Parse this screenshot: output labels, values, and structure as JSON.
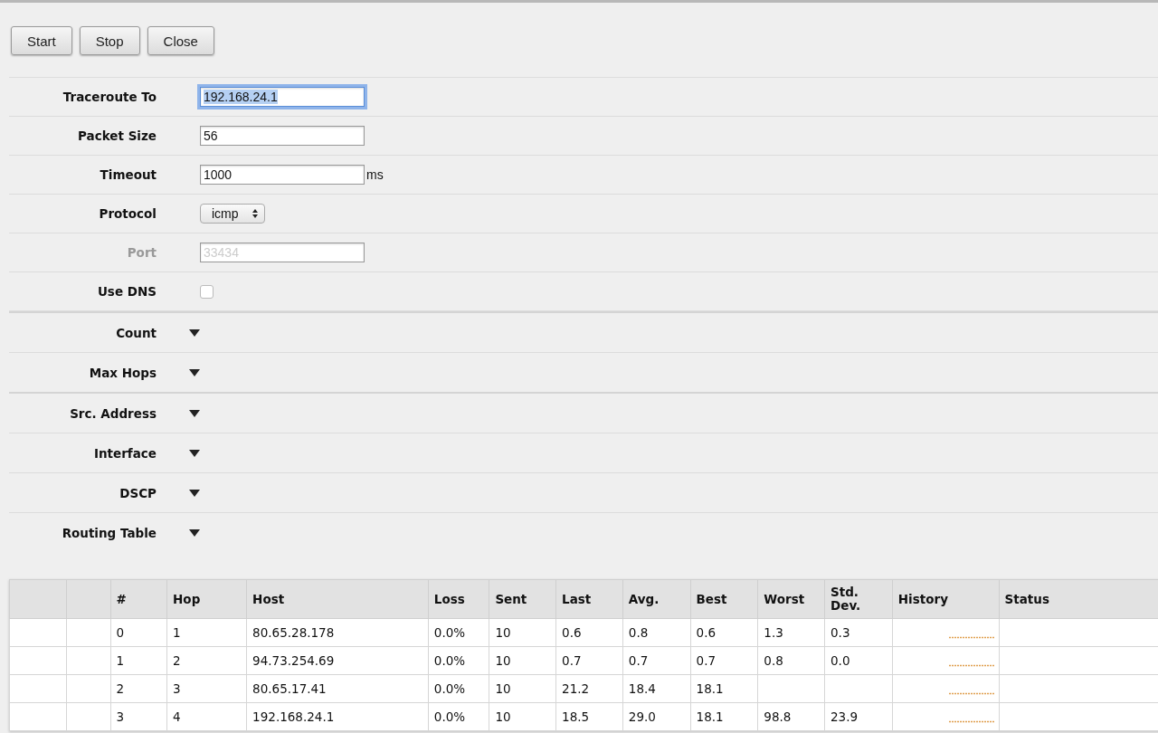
{
  "buttons": [
    {
      "label": "Start"
    },
    {
      "label": "Stop"
    },
    {
      "label": "Close"
    }
  ],
  "fields": [
    {
      "label": "Traceroute To",
      "kind": "text",
      "value": "192.168.24.1",
      "focused": true,
      "disabled": false
    },
    {
      "label": "Packet Size",
      "kind": "text",
      "value": "56",
      "focused": false,
      "disabled": false
    },
    {
      "label": "Timeout",
      "kind": "text",
      "value": "1000",
      "unit": "ms",
      "focused": false,
      "disabled": false
    },
    {
      "label": "Protocol",
      "kind": "select",
      "value": "icmp"
    },
    {
      "label": "Port",
      "kind": "text",
      "value": "33434",
      "focused": false,
      "disabled": true
    },
    {
      "label": "Use DNS",
      "kind": "checkbox",
      "checked": false
    }
  ],
  "section_groups": [
    [
      {
        "label": "Count",
        "expanded": false
      },
      {
        "label": "Max Hops",
        "expanded": false
      }
    ],
    [
      {
        "label": "Src. Address",
        "expanded": false
      },
      {
        "label": "Interface",
        "expanded": false
      },
      {
        "label": "DSCP",
        "expanded": false
      },
      {
        "label": "Routing Table",
        "expanded": false
      }
    ]
  ],
  "table": {
    "columns": [
      "#",
      "Hop",
      "Host",
      "Loss",
      "Sent",
      "Last",
      "Avg.",
      "Best",
      "Worst",
      "Std. Dev.",
      "History",
      "Status"
    ],
    "rows": [
      {
        "cells": [
          "0",
          "1",
          "80.65.28.178",
          "0.0%",
          "10",
          "0.6",
          "0.8",
          "0.6",
          "1.3",
          "0.3"
        ]
      },
      {
        "cells": [
          "1",
          "2",
          "94.73.254.69",
          "0.0%",
          "10",
          "0.7",
          "0.7",
          "0.7",
          "0.8",
          "0.0"
        ]
      },
      {
        "cells": [
          "2",
          "3",
          "80.65.17.41",
          "0.0%",
          "10",
          "21.2",
          "18.4",
          "18.1"
        ]
      },
      {
        "cells": [
          "3",
          "4",
          "192.168.24.1",
          "0.0%",
          "10",
          "18.5",
          "29.0",
          "18.1",
          "98.8",
          "23.9"
        ]
      }
    ]
  }
}
